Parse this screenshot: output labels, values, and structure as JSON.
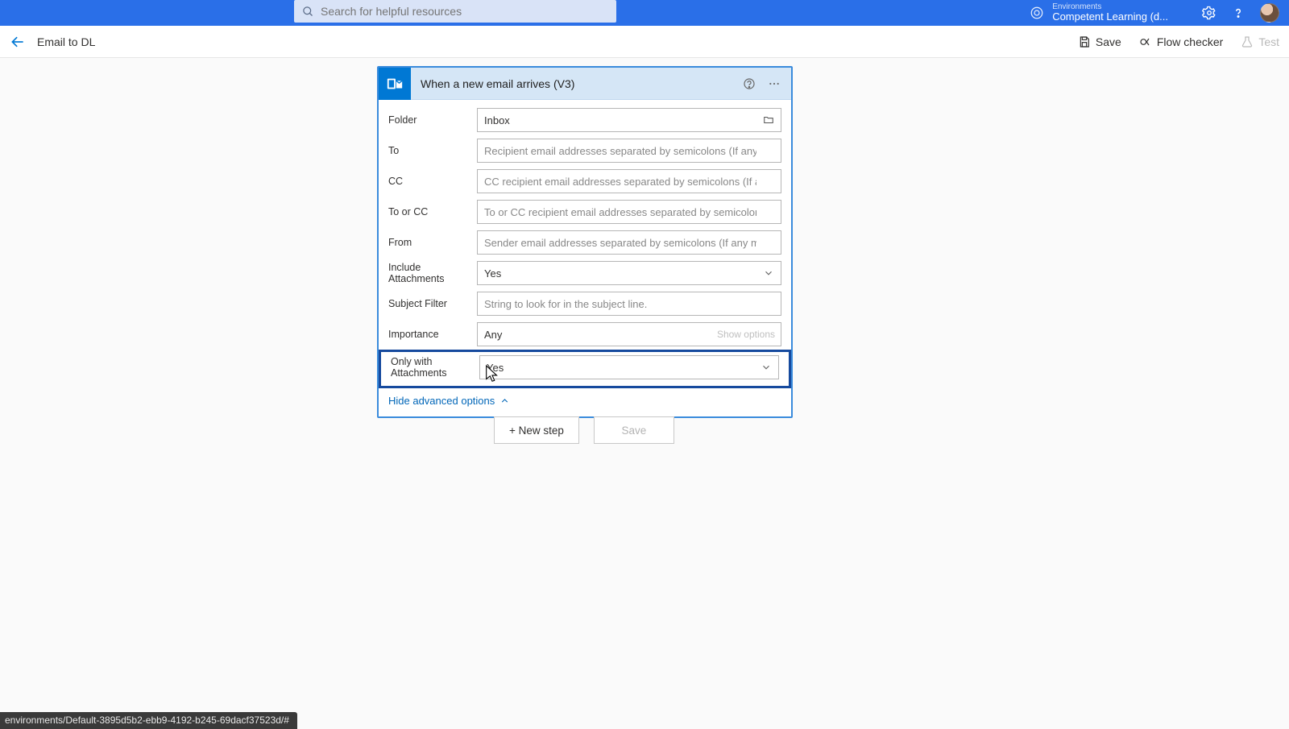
{
  "topbar": {
    "search_placeholder": "Search for helpful resources",
    "environments_label": "Environments",
    "environment_name": "Competent Learning (d..."
  },
  "commandbar": {
    "flow_title": "Email to DL",
    "save": "Save",
    "flow_checker": "Flow checker",
    "test": "Test"
  },
  "trigger": {
    "title": "When a new email arrives (V3)",
    "fields": {
      "folder_label": "Folder",
      "folder_value": "Inbox",
      "to_label": "To",
      "to_placeholder": "Recipient email addresses separated by semicolons (If any match, the",
      "cc_label": "CC",
      "cc_placeholder": "CC recipient email addresses separated by semicolons (If any match,",
      "toorcc_label": "To or CC",
      "toorcc_placeholder": "To or CC recipient email addresses separated by semicolons (If any m",
      "from_label": "From",
      "from_placeholder": "Sender email addresses separated by semicolons (If any match, the t",
      "include_att_label": "Include Attachments",
      "include_att_value": "Yes",
      "subject_label": "Subject Filter",
      "subject_placeholder": "String to look for in the subject line.",
      "importance_label": "Importance",
      "importance_value": "Any",
      "show_options": "Show options",
      "only_att_label": "Only with Attachments",
      "only_att_value": "Yes"
    },
    "advanced_toggle": "Hide advanced options"
  },
  "footer": {
    "new_step": "+ New step",
    "save": "Save"
  },
  "status_url": "environments/Default-3895d5b2-ebb9-4192-b245-69dacf37523d/#"
}
